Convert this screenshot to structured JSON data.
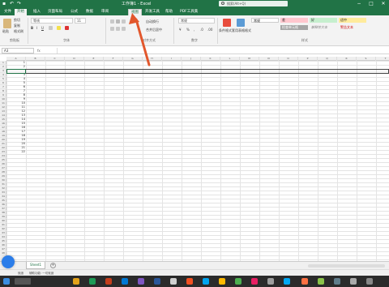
{
  "title_bar": {
    "quick_access": [
      "Save",
      "Undo",
      "Redo"
    ],
    "doc_title": "工作簿1 - Excel",
    "search_placeholder": "搜索(Alt+Q)",
    "window_controls": [
      "minimize",
      "maximize",
      "close"
    ]
  },
  "tabs": [
    {
      "label": "文件",
      "state": "normal"
    },
    {
      "label": "开始",
      "state": "active"
    },
    {
      "label": "插入",
      "state": "normal"
    },
    {
      "label": "页面布局",
      "state": "normal"
    },
    {
      "label": "公式",
      "state": "normal"
    },
    {
      "label": "数据",
      "state": "normal"
    },
    {
      "label": "审阅",
      "state": "normal"
    },
    {
      "label": "视图",
      "state": "highlighted"
    },
    {
      "label": "开发工具",
      "state": "normal"
    },
    {
      "label": "帮助",
      "state": "normal"
    },
    {
      "label": "PDF工具集",
      "state": "normal"
    }
  ],
  "ribbon": {
    "groups": [
      "剪贴板",
      "字体",
      "对齐方式",
      "数字",
      "样式"
    ],
    "clipboard": {
      "paste": "粘贴",
      "items": [
        "剪切",
        "复制",
        "格式刷"
      ]
    },
    "font": {
      "name": "等线",
      "size": "11"
    },
    "alignment": {
      "wrap": "自动换行",
      "merge": "合并后居中"
    },
    "number": {
      "format": "常规"
    },
    "styles": {
      "conditional": "条件格式",
      "table": "套用表格格式",
      "cells": [
        {
          "label": "常规",
          "color": "#ffffff"
        },
        {
          "label": "差",
          "color": "#ffc7ce"
        },
        {
          "label": "好",
          "color": "#c6efce"
        },
        {
          "label": "适中",
          "color": "#ffeb9c"
        },
        {
          "label": "检查单元格",
          "color": "#a5a5a5"
        },
        {
          "label": "解释性文本",
          "color": "#ffffff"
        },
        {
          "label": "警告文本",
          "color": "#ffffff"
        }
      ]
    }
  },
  "formula_bar": {
    "name_box": "A3",
    "fx": "fx"
  },
  "columns": [
    "A",
    "B",
    "C",
    "D",
    "E",
    "F",
    "G",
    "H",
    "I",
    "J",
    "K",
    "L",
    "M",
    "N",
    "O",
    "P",
    "Q",
    "R",
    "S",
    "T"
  ],
  "rows": [
    "1",
    "2",
    "3",
    "4",
    "5",
    "6",
    "7",
    "8",
    "9",
    "10",
    "11",
    "12",
    "13",
    "14",
    "15",
    "16",
    "17",
    "18",
    "19",
    "20",
    "21",
    "22",
    "23",
    "24",
    "25",
    "26",
    "27",
    "28",
    "29",
    "30",
    "31",
    "32",
    "33",
    "34",
    "35",
    "36",
    "37",
    "38",
    "39",
    "40",
    "41",
    "42",
    "43",
    "44",
    "45",
    "46",
    "47",
    "48"
  ],
  "cell_values": [
    "1",
    "2",
    "",
    "3",
    "4",
    "5",
    "6",
    "7",
    "8",
    "9",
    "10",
    "11",
    "12",
    "13",
    "14",
    "15",
    "16",
    "17",
    "18",
    "19",
    "20",
    "21",
    "22"
  ],
  "sheet_tabs": [
    "Sheet1"
  ],
  "status_bar": {
    "ready": "就绪",
    "accessibility": "辅助功能: 一切就绪"
  },
  "colors": {
    "excel_green": "#217346",
    "arrow": "#e2572c",
    "circle": "#2b7de9"
  }
}
